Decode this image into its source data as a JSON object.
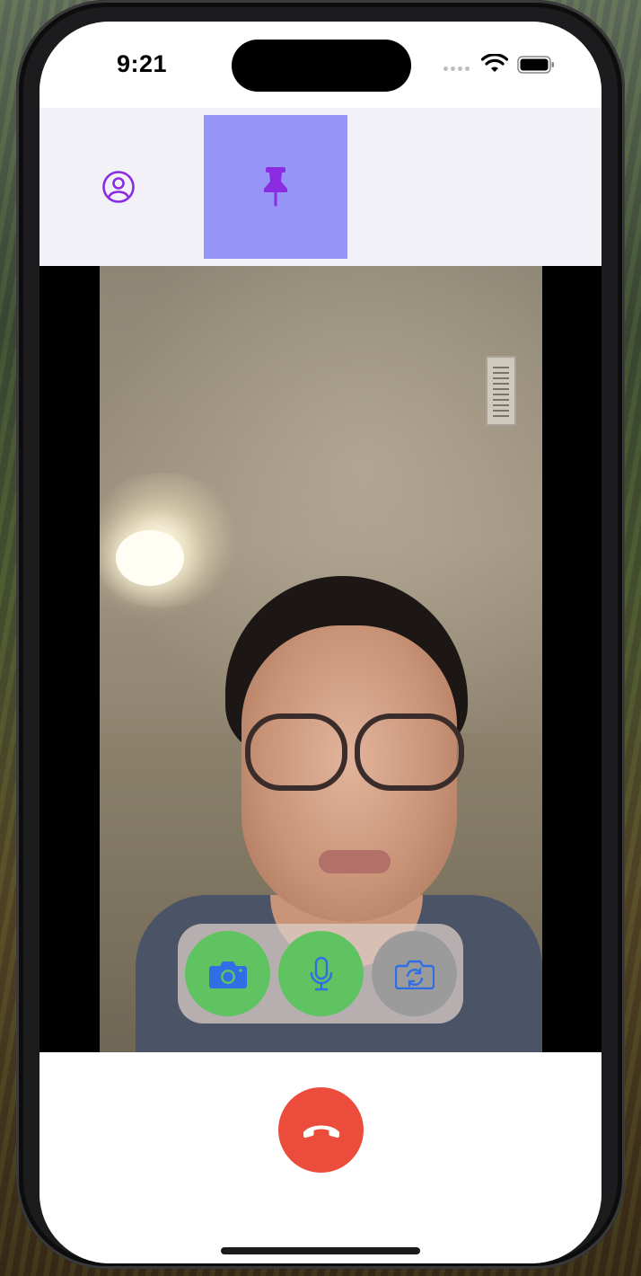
{
  "status_bar": {
    "time": "9:21"
  },
  "topbar": {
    "participants_icon": "person-circle-icon",
    "pin_icon": "pin-icon",
    "selected_tab": "pin",
    "accent_color": "#8b2be2",
    "selected_bg_color": "#9694f7"
  },
  "video": {
    "controls": [
      {
        "name": "camera",
        "icon": "camera-icon",
        "state": "on",
        "color": "#5fc361"
      },
      {
        "name": "microphone",
        "icon": "microphone-icon",
        "state": "on",
        "color": "#5fc361"
      },
      {
        "name": "switch-camera",
        "icon": "camera-rotate-icon",
        "state": "inactive",
        "color": "#9b9b9b"
      }
    ],
    "control_icon_color": "#2f6fe6"
  },
  "bottom": {
    "end_call_icon": "phone-hangup-icon",
    "end_call_color": "#eb4c3c"
  }
}
